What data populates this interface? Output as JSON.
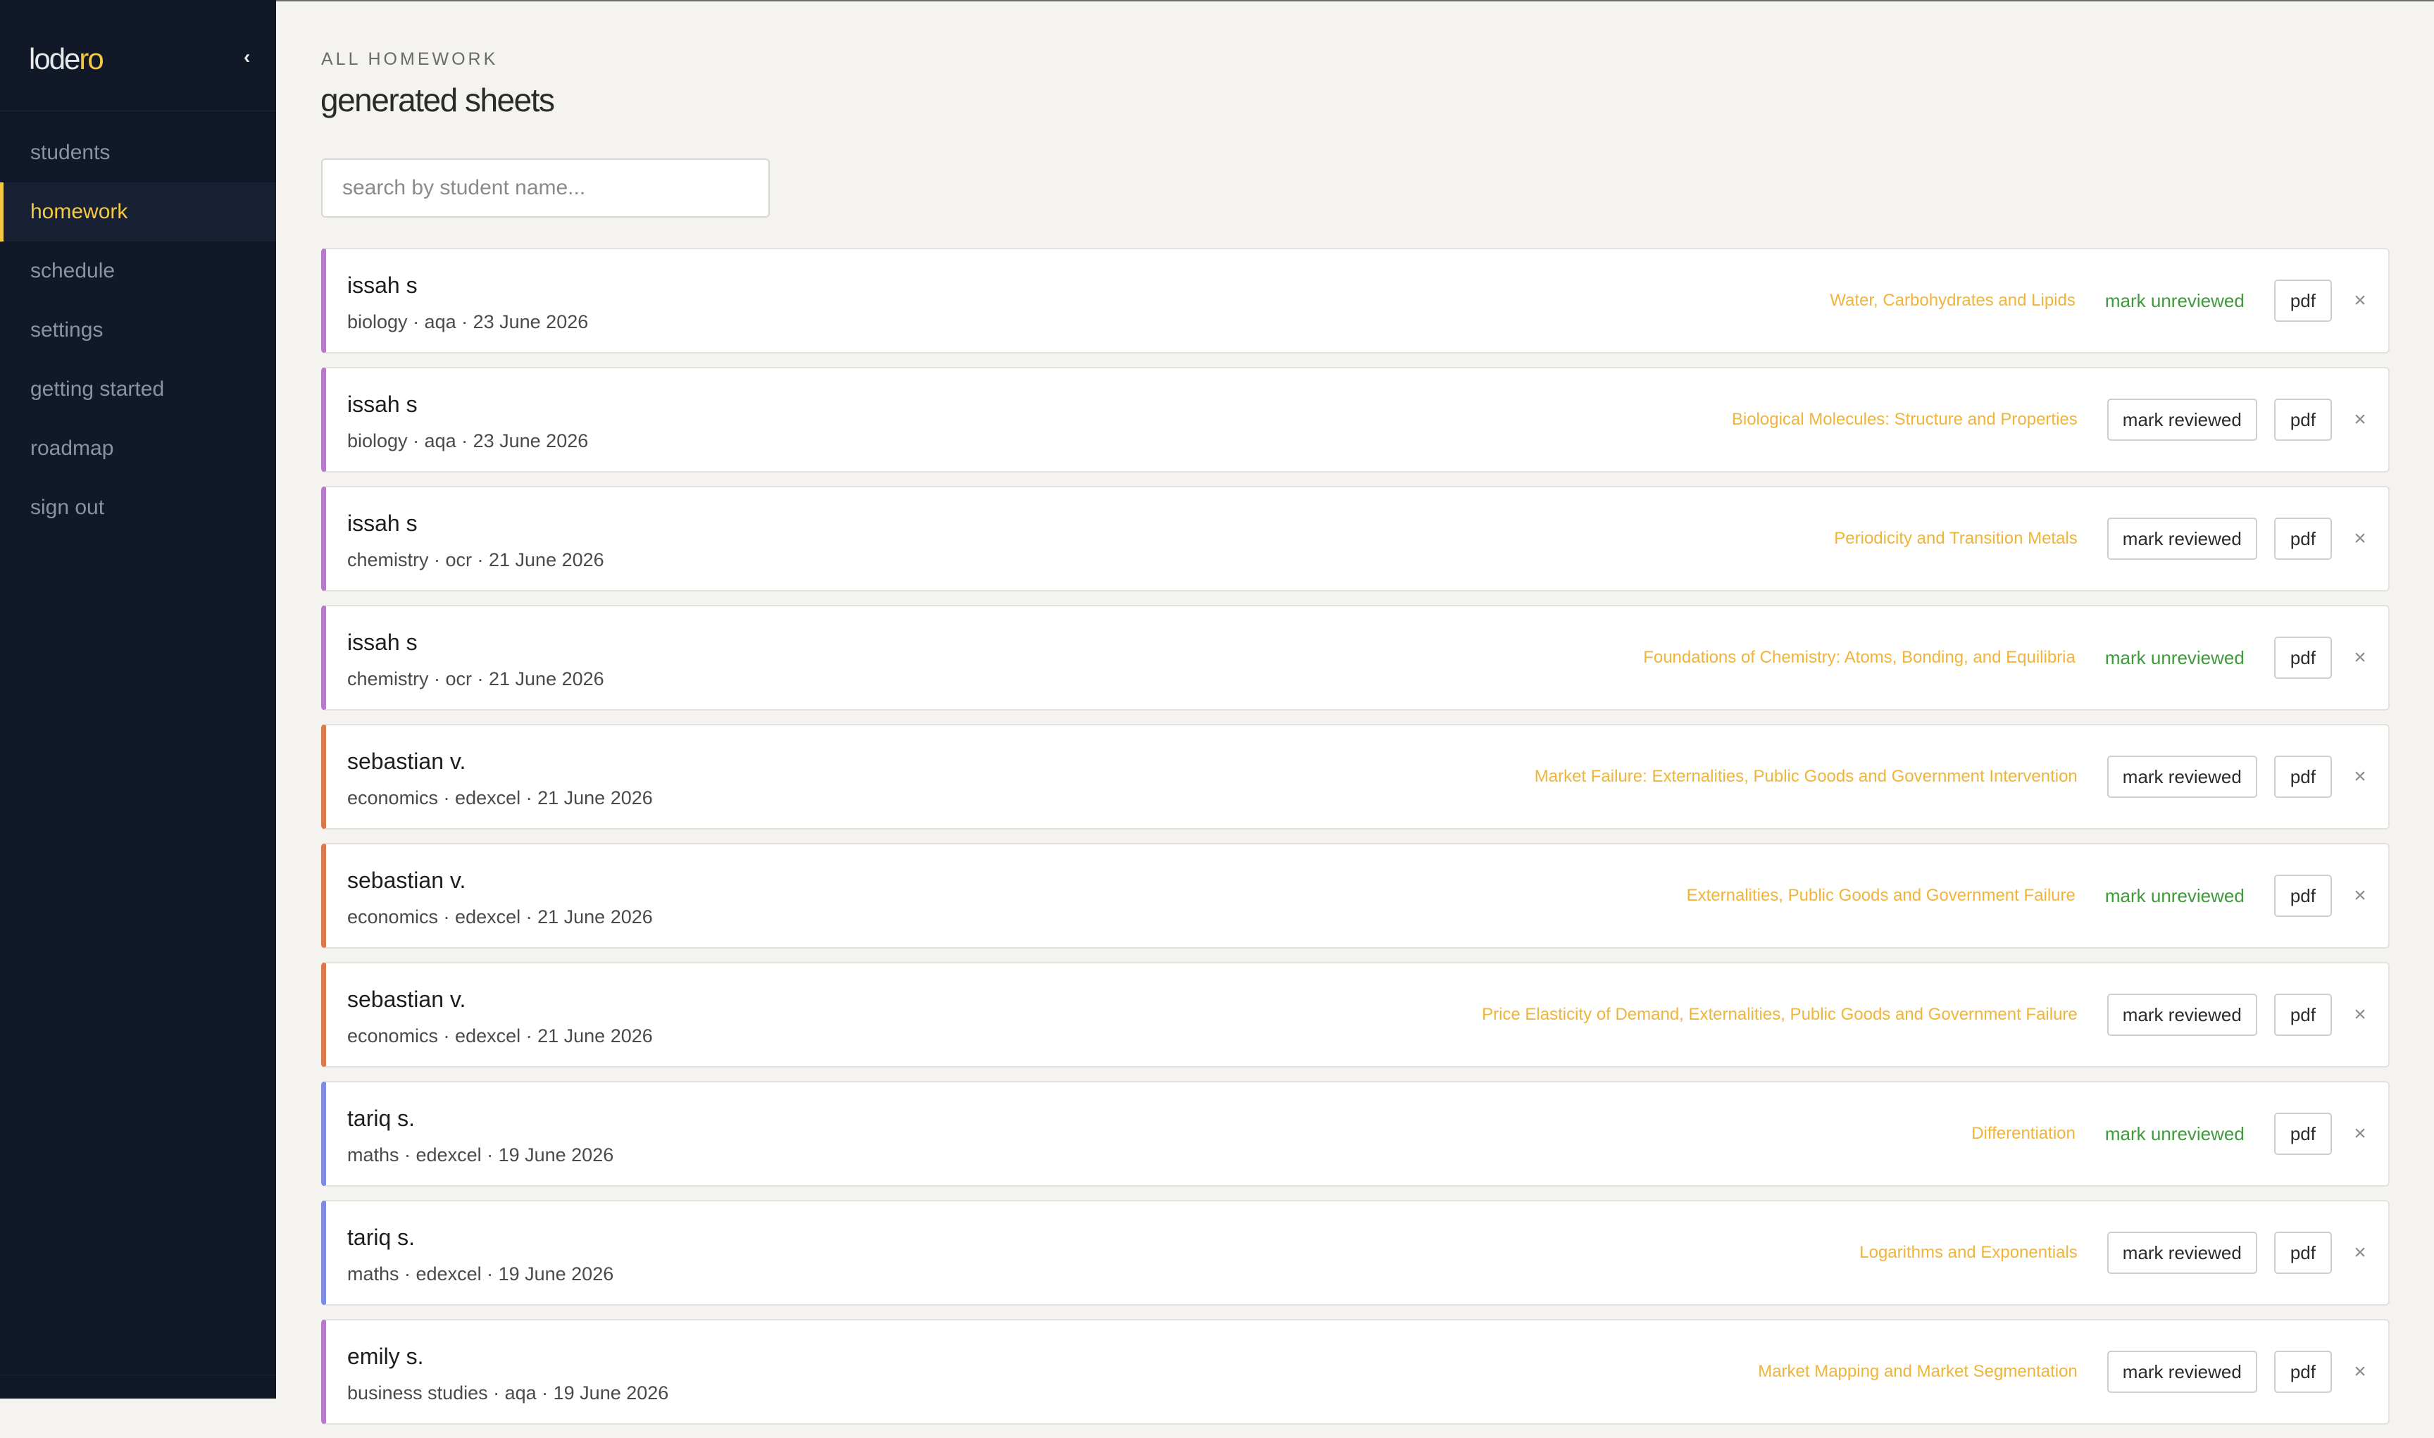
{
  "app": {
    "logo_main": "lode",
    "logo_accent": "ro",
    "collapse_icon": "‹"
  },
  "sidebar": {
    "items": [
      {
        "label": "students",
        "active": false
      },
      {
        "label": "homework",
        "active": true
      },
      {
        "label": "schedule",
        "active": false
      },
      {
        "label": "settings",
        "active": false
      },
      {
        "label": "getting started",
        "active": false
      },
      {
        "label": "roadmap",
        "active": false
      },
      {
        "label": "sign out",
        "active": false
      }
    ]
  },
  "header": {
    "eyebrow": "ALL HOMEWORK",
    "title": "generated sheets"
  },
  "search": {
    "placeholder": "search by student name...",
    "value": ""
  },
  "labels": {
    "mark_reviewed": "mark reviewed",
    "mark_unreviewed": "mark unreviewed",
    "pdf": "pdf",
    "close": "×"
  },
  "colors": {
    "accent": "#f5c842",
    "biology_chemistry": "#b57bc9",
    "economics": "#d97a4e",
    "maths": "#7d8be0",
    "unreviewed": "#3e9a3a",
    "topic": "#f0b43a"
  },
  "homework": [
    {
      "name": "issah s",
      "meta": "biology · aqa · 23 June 2026",
      "topic": "Water, Carbohydrates and Lipids",
      "reviewed": true,
      "action": "mark unreviewed"
    },
    {
      "name": "issah s",
      "meta": "biology · aqa · 23 June 2026",
      "topic": "Biological Molecules: Structure and Properties",
      "reviewed": false,
      "action": "mark reviewed"
    },
    {
      "name": "issah s",
      "meta": "chemistry · ocr · 21 June 2026",
      "topic": "Periodicity and Transition Metals",
      "reviewed": false,
      "action": "mark reviewed"
    },
    {
      "name": "issah s",
      "meta": "chemistry · ocr · 21 June 2026",
      "topic": "Foundations of Chemistry: Atoms, Bonding, and Equilibria",
      "reviewed": true,
      "action": "mark unreviewed"
    },
    {
      "name": "sebastian v.",
      "meta": "economics · edexcel · 21 June 2026",
      "topic": "Market Failure: Externalities, Public Goods and Government Intervention",
      "reviewed": false,
      "action": "mark reviewed"
    },
    {
      "name": "sebastian v.",
      "meta": "economics · edexcel · 21 June 2026",
      "topic": "Externalities, Public Goods and Government Failure",
      "reviewed": true,
      "action": "mark unreviewed"
    },
    {
      "name": "sebastian v.",
      "meta": "economics · edexcel · 21 June 2026",
      "topic": "Price Elasticity of Demand, Externalities, Public Goods and Government Failure",
      "reviewed": false,
      "action": "mark reviewed"
    },
    {
      "name": "tariq s.",
      "meta": "maths · edexcel · 19 June 2026",
      "topic": "Differentiation",
      "reviewed": true,
      "action": "mark unreviewed"
    },
    {
      "name": "tariq s.",
      "meta": "maths · edexcel · 19 June 2026",
      "topic": "Logarithms and Exponentials",
      "reviewed": false,
      "action": "mark reviewed"
    },
    {
      "name": "emily s.",
      "meta": "business studies · aqa · 19 June 2026",
      "topic": "Market Mapping and Market Segmentation",
      "reviewed": false,
      "action": "mark reviewed"
    }
  ]
}
